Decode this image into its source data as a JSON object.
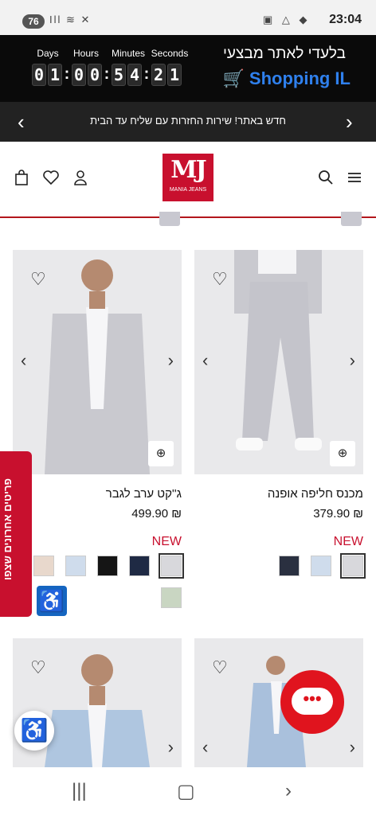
{
  "status_bar": {
    "badge": "76",
    "left_icons": "Ill ≋ ✕",
    "right_icons": "▣ △ ◆",
    "time": "23:04"
  },
  "promo": {
    "countdown_labels": [
      "Days",
      "Hours",
      "Minutes",
      "Seconds"
    ],
    "countdown_digits": [
      "0",
      "1",
      "0",
      "0",
      "5",
      "4",
      "2",
      "1"
    ],
    "title": "בלעדי לאתר מבצעי",
    "brand": "Shopping IL"
  },
  "announcement": {
    "text": "חדש באתר! שירות החזרות עם שליח עד הבית"
  },
  "header": {
    "logo_mark": "MJ",
    "logo_sub": "MANIA JEANS"
  },
  "products": [
    {
      "name": "מכנס חליפה אופנה",
      "price": "379.90 ₪",
      "badge": "NEW",
      "swatches": [
        "#d8d8dc",
        "#cfdcec",
        "#2a3040"
      ]
    },
    {
      "name": "ג''קט ערב לגבר",
      "price": "499.90 ₪",
      "badge": "NEW",
      "swatches": [
        "#d8d8dc",
        "#1f2a44",
        "#151515",
        "#cfdcec",
        "#e8d8cc",
        "#c9d6c2"
      ]
    }
  ],
  "side_tab": {
    "label": "פריטים אחרונים שצפו"
  },
  "colors": {
    "brand_red": "#c8102e",
    "promo_blue": "#2f80ed",
    "dark": "#0a0a0a"
  }
}
